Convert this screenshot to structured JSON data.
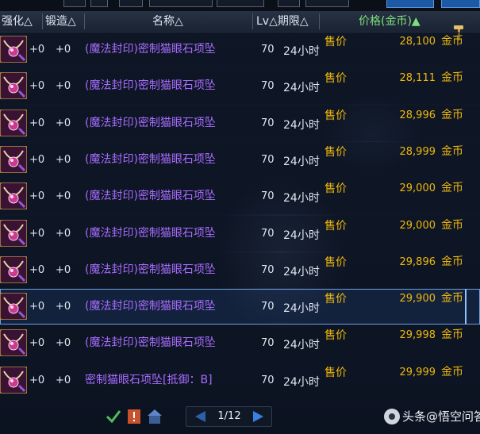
{
  "header": {
    "strengthen": "强化△",
    "forge": "锻造△",
    "name": "名称△",
    "lv_period": "Lv△期限△",
    "price": "价格(金币)▲",
    "colors": {
      "price_sort_active": "#7fe07a"
    }
  },
  "icons": {
    "tools": "hammer-icon",
    "item": "necklace-icon",
    "prev": "triangle-left-icon",
    "next": "triangle-right-icon"
  },
  "rows": [
    {
      "strengthen": "+0",
      "forge": "+0",
      "name": "(魔法封印)密制猫眼石项坠",
      "level": "70",
      "period": "24小时",
      "sale": "售价",
      "price": "28,100",
      "currency": "金币",
      "selected": false
    },
    {
      "strengthen": "+0",
      "forge": "+0",
      "name": "(魔法封印)密制猫眼石项坠",
      "level": "70",
      "period": "24小时",
      "sale": "售价",
      "price": "28,111",
      "currency": "金币",
      "selected": false
    },
    {
      "strengthen": "+0",
      "forge": "+0",
      "name": "(魔法封印)密制猫眼石项坠",
      "level": "70",
      "period": "24小时",
      "sale": "售价",
      "price": "28,996",
      "currency": "金币",
      "selected": false
    },
    {
      "strengthen": "+0",
      "forge": "+0",
      "name": "(魔法封印)密制猫眼石项坠",
      "level": "70",
      "period": "24小时",
      "sale": "售价",
      "price": "28,999",
      "currency": "金币",
      "selected": false
    },
    {
      "strengthen": "+0",
      "forge": "+0",
      "name": "(魔法封印)密制猫眼石项坠",
      "level": "70",
      "period": "24小时",
      "sale": "售价",
      "price": "29,000",
      "currency": "金币",
      "selected": false
    },
    {
      "strengthen": "+0",
      "forge": "+0",
      "name": "(魔法封印)密制猫眼石项坠",
      "level": "70",
      "period": "24小时",
      "sale": "售价",
      "price": "29,000",
      "currency": "金币",
      "selected": false
    },
    {
      "strengthen": "+0",
      "forge": "+0",
      "name": "(魔法封印)密制猫眼石项坠",
      "level": "70",
      "period": "24小时",
      "sale": "售价",
      "price": "29,896",
      "currency": "金币",
      "selected": false
    },
    {
      "strengthen": "+0",
      "forge": "+0",
      "name": "(魔法封印)密制猫眼石项坠",
      "level": "70",
      "period": "24小时",
      "sale": "售价",
      "price": "29,900",
      "currency": "金币",
      "selected": true
    },
    {
      "strengthen": "+0",
      "forge": "+0",
      "name": "(魔法封印)密制猫眼石项坠",
      "level": "70",
      "period": "24小时",
      "sale": "售价",
      "price": "29,998",
      "currency": "金币",
      "selected": false
    },
    {
      "strengthen": "+0",
      "forge": "+0",
      "name": "密制猫眼石项坠[抵御：B]",
      "level": "70",
      "period": "24小时",
      "sale": "售价",
      "price": "29,999",
      "currency": "金币",
      "selected": false
    }
  ],
  "pager": {
    "label": "1/12"
  },
  "watermark": "头条@悟空问答"
}
